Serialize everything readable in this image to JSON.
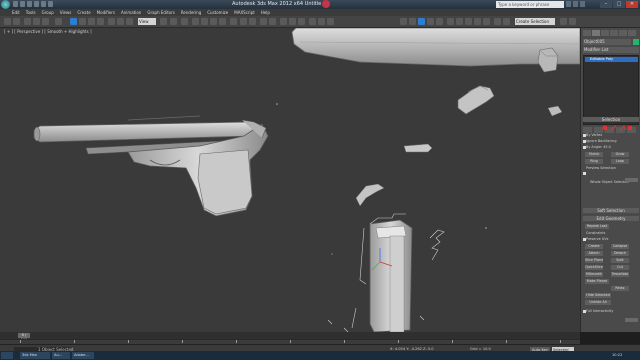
{
  "window": {
    "title": "Autodesk 3ds Max  2012 x64",
    "title_suffix": "Untitle",
    "search_placeholder": "Type a keyword or phrase",
    "min": "–",
    "max": "□",
    "close": "✕"
  },
  "menu": [
    "Edit",
    "Tools",
    "Group",
    "Views",
    "Create",
    "Modifiers",
    "Animation",
    "Graph Editors",
    "Rendering",
    "Customize",
    "MAXScript",
    "Help"
  ],
  "toolbar": {
    "view_dropdown": "View",
    "selection_set": "Create Selection Se"
  },
  "viewport": {
    "label": "[ + ] [ Perspective ] [ Smooth + Highlights ]"
  },
  "command_panel": {
    "object_name": "Object005",
    "modifier_list": "Modifier List",
    "stack_item": "Editable Poly",
    "rollouts": {
      "selection": "Selection",
      "soft_selection": "Soft Selection",
      "edit_geometry": "Edit Geometry"
    },
    "selection_options": [
      "By Vertex",
      "Ignore Backfacing",
      "By Angle: 45.0"
    ],
    "shrink": "Shrink",
    "grow": "Grow",
    "ring": "Ring",
    "loop": "Loop",
    "preview_selection": "Preview Selection",
    "whole_object": "Whole Object Selected",
    "repeat_last": "Repeat Last",
    "constraints": "Constraints",
    "preserve_uvs": "Preserve UVs",
    "create": "Create",
    "collapse": "Collapse",
    "attach": "Attach",
    "detach": "Detach",
    "slice_plane": "Slice Plane",
    "split": "Split",
    "quickslice": "QuickSlice",
    "cut": "Cut",
    "msmooth": "MSmooth",
    "tessellate": "Tessellate",
    "make_planar": "Make Planar",
    "relax": "Relax",
    "hide_selected": "Hide Selected",
    "unhide_all": "Unhide All",
    "full_interactivity": "Full Interactivity"
  },
  "timeline": {
    "slider_label": "0 / 100",
    "ticks": [
      0,
      10,
      20,
      30,
      40,
      50,
      60,
      70,
      80,
      90,
      100
    ]
  },
  "status": {
    "message": "1 Object Selected",
    "axis": "X: 4.054   Y: -4.262   Z: 0.0",
    "grid": "Grid = 10.0",
    "add_time_tag": "Add Time Tag",
    "auto_key": "Auto Key",
    "selected": "Selected",
    "set_key": "Set Key"
  },
  "taskbar": {
    "items": [
      "3ds Max",
      "Au...",
      "Adobe..."
    ],
    "clock": "10:22"
  }
}
